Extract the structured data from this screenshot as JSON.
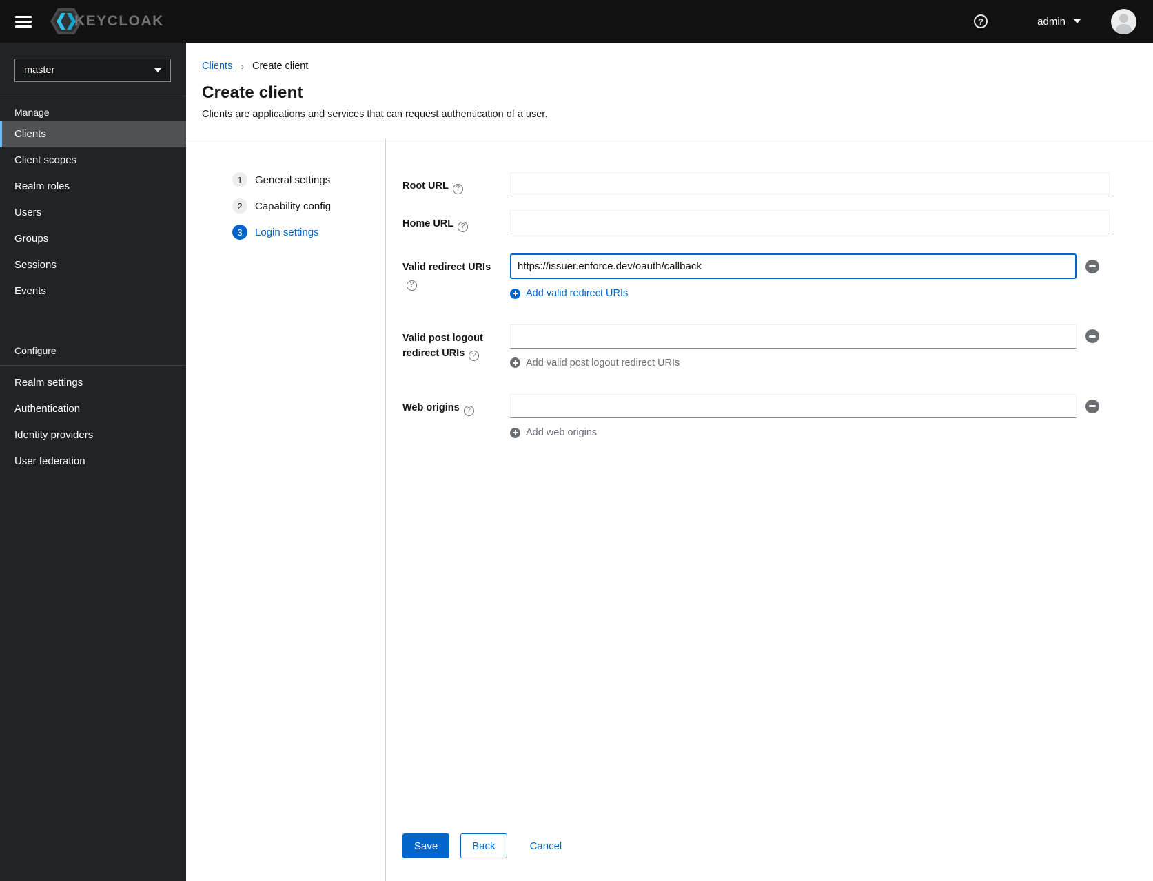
{
  "colors": {
    "primary": "#0066cc",
    "topbar_bg": "#121212",
    "sidebar_bg": "#212427",
    "sidebar_selected_bg": "#4f5255",
    "sidebar_selected_accent": "#73bcf7",
    "muted_text": "#6a6e73",
    "divider": "#d2d2d2"
  },
  "topbar": {
    "brand": "KEYCLOAK",
    "username": "admin"
  },
  "sidebar": {
    "realm_selector": {
      "value": "master"
    },
    "selected_item": "Clients",
    "sections": [
      {
        "title": "Manage",
        "items": [
          "Clients",
          "Client scopes",
          "Realm roles",
          "Users",
          "Groups",
          "Sessions",
          "Events"
        ]
      },
      {
        "title": "Configure",
        "items": [
          "Realm settings",
          "Authentication",
          "Identity providers",
          "User federation"
        ]
      }
    ]
  },
  "breadcrumb": {
    "parent": "Clients",
    "current": "Create client"
  },
  "page_header": {
    "title": "Create client",
    "subtitle": "Clients are applications and services that can request authentication of a user."
  },
  "wizard": {
    "steps": [
      {
        "number": "1",
        "label": "General settings",
        "state": "visited"
      },
      {
        "number": "2",
        "label": "Capability config",
        "state": "visited"
      },
      {
        "number": "3",
        "label": "Login settings",
        "state": "current"
      }
    ]
  },
  "form": {
    "fields": [
      {
        "label": "Root URL",
        "value": "",
        "removable": false
      },
      {
        "label": "Home URL",
        "value": "",
        "removable": false
      },
      {
        "label": "Valid redirect URIs",
        "value": "https://issuer.enforce.dev/oauth/callback",
        "removable": true,
        "focused": true,
        "add_action": {
          "label": "Add valid redirect URIs",
          "enabled": true
        }
      },
      {
        "label": "Valid post logout redirect URIs",
        "value": "",
        "removable": true,
        "add_action": {
          "label": "Add valid post logout redirect URIs",
          "enabled": false
        }
      },
      {
        "label": "Web origins",
        "value": "",
        "removable": true,
        "add_action": {
          "label": "Add web origins",
          "enabled": false
        }
      }
    ],
    "actions": {
      "save": "Save",
      "back": "Back",
      "cancel": "Cancel"
    }
  }
}
